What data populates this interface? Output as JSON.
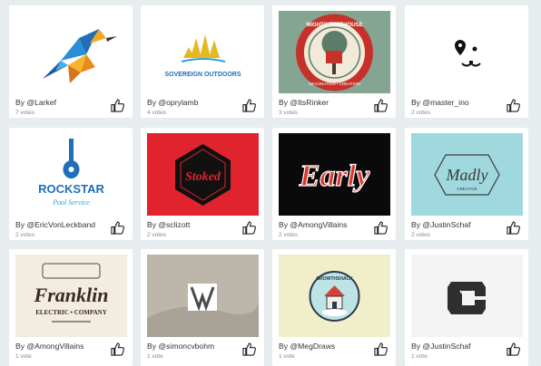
{
  "cards": [
    {
      "author": "By @Larkef",
      "votes": "7 votes",
      "bg": "#ffffff",
      "logo_text": "",
      "logo_text2": ""
    },
    {
      "author": "By @oprylamb",
      "votes": "4 votes",
      "bg": "#ffffff",
      "logo_text": "SOVEREIGN OUTDOORS",
      "logo_text2": ""
    },
    {
      "author": "By @ItsRinker",
      "votes": "3 votes",
      "bg": "#84a592",
      "logo_text": "MIGHTY TREEHOUSE",
      "logo_text2": "IMAGINATION • CREATION"
    },
    {
      "author": "By @master_ino",
      "votes": "2 votes",
      "bg": "#ffffff",
      "logo_text": "",
      "logo_text2": ""
    },
    {
      "author": "By @EricVonLeckband",
      "votes": "2 votes",
      "bg": "#ffffff",
      "logo_text": "ROCKSTAR",
      "logo_text2": "Pool Service"
    },
    {
      "author": "By @sclizott",
      "votes": "2 votes",
      "bg": "#e1232e",
      "logo_text": "Stoked",
      "logo_text2": ""
    },
    {
      "author": "By @AmongVillains",
      "votes": "2 votes",
      "bg": "#0a0a0a",
      "logo_text": "Early",
      "logo_text2": ""
    },
    {
      "author": "By @JustinSchaf",
      "votes": "2 votes",
      "bg": "#9fd9df",
      "logo_text": "Madly",
      "logo_text2": "CREATIVE"
    },
    {
      "author": "By @AmongVillains",
      "votes": "1 vote",
      "bg": "#f3ece0",
      "logo_text": "Franklin",
      "logo_text2": "ELECTRIC • COMPANY"
    },
    {
      "author": "By @simoncvbohm",
      "votes": "1 vote",
      "bg": "#b9b3aa",
      "logo_text": "",
      "logo_text2": ""
    },
    {
      "author": "By @MegDraws",
      "votes": "1 vote",
      "bg": "#f0efc9",
      "logo_text": "GROWTHSHACK",
      "logo_text2": ""
    },
    {
      "author": "By @JustinSchaf",
      "votes": "1 vote",
      "bg": "#f4f4f4",
      "logo_text": "",
      "logo_text2": ""
    }
  ],
  "icons": {
    "like": "thumbs-up-icon"
  }
}
